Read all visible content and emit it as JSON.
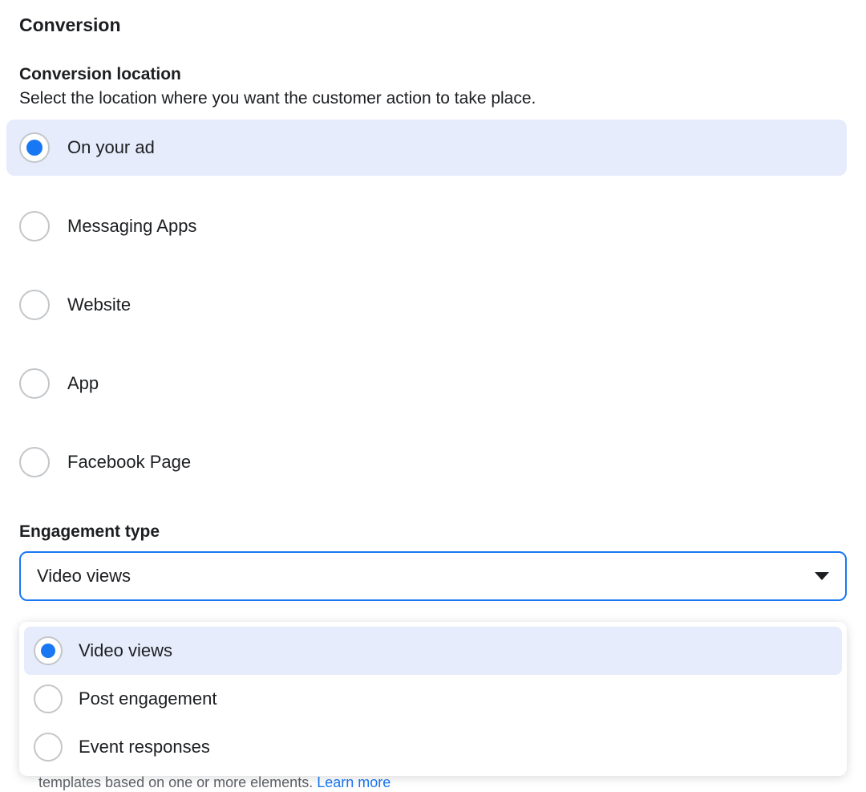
{
  "section_title": "Conversion",
  "conversion_location": {
    "label": "Conversion location",
    "description": "Select the location where you want the customer action to take place.",
    "options": [
      {
        "label": "On your ad",
        "selected": true
      },
      {
        "label": "Messaging Apps",
        "selected": false
      },
      {
        "label": "Website",
        "selected": false
      },
      {
        "label": "App",
        "selected": false
      },
      {
        "label": "Facebook Page",
        "selected": false
      }
    ]
  },
  "engagement_type": {
    "label": "Engagement type",
    "selected_value": "Video views",
    "options": [
      {
        "label": "Video views",
        "selected": true
      },
      {
        "label": "Post engagement",
        "selected": false
      },
      {
        "label": "Event responses",
        "selected": false
      }
    ]
  },
  "clipped_text_fragment": "templates based on one or more elements.",
  "clipped_link_text": "Learn more"
}
